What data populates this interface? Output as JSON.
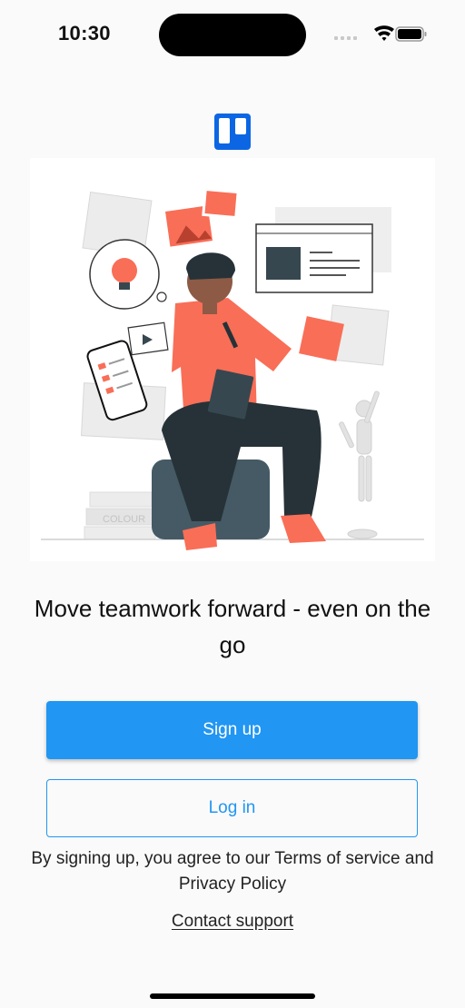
{
  "status_bar": {
    "time": "10:30",
    "icons": [
      "cellular-icon",
      "wifi-icon",
      "battery-icon"
    ]
  },
  "logo": {
    "icon": "trello-logo-icon",
    "color": "#0c66e4"
  },
  "hero": {
    "illustration": "person-sitting-thinking-illustration",
    "accent_color": "#f96e57",
    "label_text": "COLOUR"
  },
  "headline": "Move teamwork forward - even on the go",
  "buttons": {
    "signup_label": "Sign up",
    "login_label": "Log in",
    "primary_color": "#2196f3"
  },
  "legal": {
    "line1": "By signing up, you agree to our Terms of service and",
    "line2": "Privacy Policy"
  },
  "support_link": "Contact support"
}
